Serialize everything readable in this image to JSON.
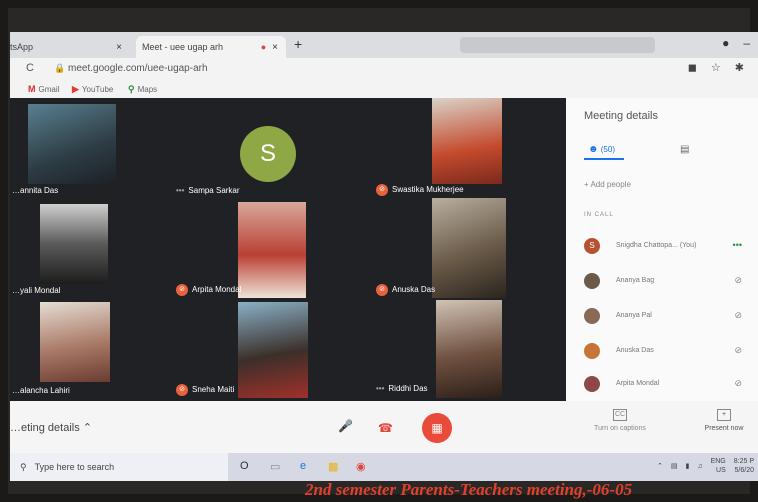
{
  "browser": {
    "tabs": [
      {
        "label": "tsApp",
        "close": "×"
      },
      {
        "label": "Meet - uee ugap arh",
        "close": "×"
      }
    ],
    "new_tab": "+",
    "url": "meet.google.com/uee-ugap-arh",
    "bookmarks": [
      "Gmail",
      "YouTube",
      "Maps"
    ]
  },
  "meeting": {
    "tiles": [
      {
        "name": "…annita Das"
      },
      {
        "name": "Sampa Sarkar",
        "avatar_letter": "S",
        "avatar_color": "#8fa846"
      },
      {
        "name": "Swastika Mukherjee"
      },
      {
        "name": "…yali Mondal"
      },
      {
        "name": "Arpita Mondal"
      },
      {
        "name": "Anuska Das"
      },
      {
        "name": "…alancha Lahiri"
      },
      {
        "name": "Sneha Maiti"
      },
      {
        "name": "Riddhi Das"
      }
    ]
  },
  "panel": {
    "title": "Meeting details",
    "people_tab": "(50)",
    "add_people": "Add people",
    "in_call_label": "IN CALL",
    "participants": [
      {
        "name": "Snigdha Chattopa... (You)",
        "avatar": "S",
        "color": "#b5522f"
      },
      {
        "name": "Ananya Bag",
        "color": "#6b5a4a"
      },
      {
        "name": "Ananya Pal",
        "color": "#8a6a55"
      },
      {
        "name": "Anuska Das",
        "color": "#c7743a"
      },
      {
        "name": "Arpita Mondal",
        "color": "#8a4a4a"
      }
    ]
  },
  "controls": {
    "meeting_details": "…eting details",
    "captions": "Turn on captions",
    "present": "Present now"
  },
  "taskbar": {
    "search_placeholder": "Type here to search",
    "lang": "ENG",
    "region": "US",
    "time": "8:25 P",
    "date": "5/6/20"
  },
  "banner": "2nd semester Parents-Teachers meeting,-06-05"
}
